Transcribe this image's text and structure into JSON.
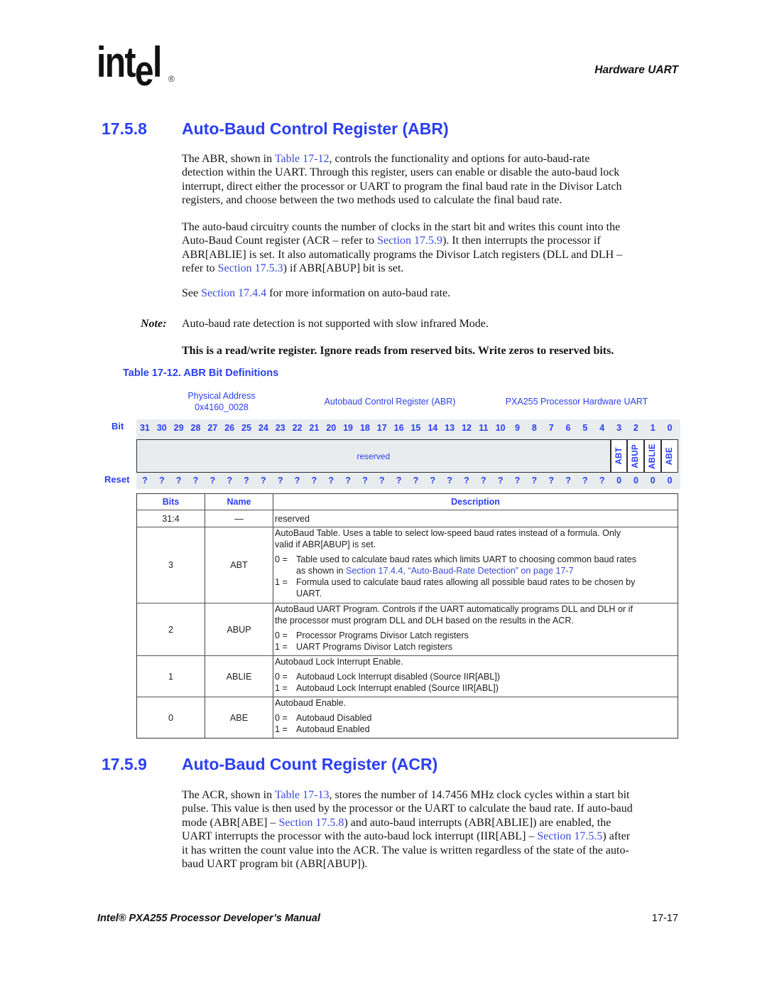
{
  "header": {
    "logo": {
      "part1": "int",
      "part2": "e",
      "part3": "l"
    },
    "logo_mark": "®",
    "section_label": "Hardware UART"
  },
  "section_abr": {
    "number": "17.5.8",
    "title": "Auto-Baud Control Register (ABR)",
    "paragraph1": [
      [
        {
          "t": "The ABR, shown in "
        },
        {
          "t": "Table 17-12",
          "link": true
        },
        {
          "t": ", controls the functionality and options for auto-baud-rate"
        }
      ],
      [
        {
          "t": "detection within the UART. Through this register, users can enable or disable the auto-baud lock"
        }
      ],
      [
        {
          "t": "interrupt, direct either the processor or UART to program the final baud rate in the Divisor Latch"
        }
      ],
      [
        {
          "t": "registers, and choose between the two methods used to calculate the final baud rate."
        }
      ]
    ],
    "paragraph2": [
      [
        {
          "t": "The auto-baud circuitry counts the number of clocks in the start bit and writes this count into the"
        }
      ],
      [
        {
          "t": "Auto-Baud Count register (ACR – refer to "
        },
        {
          "t": "Section 17.5.9",
          "link": true
        },
        {
          "t": "). It then interrupts the processor if"
        }
      ],
      [
        {
          "t": "ABR[ABLIE] is set. It also automatically programs the Divisor Latch registers (DLL and DLH –"
        }
      ],
      [
        {
          "t": "refer to "
        },
        {
          "t": "Section 17.5.3",
          "link": true
        },
        {
          "t": ") if ABR[ABUP] bit is set."
        }
      ]
    ],
    "paragraph3": [
      [
        {
          "t": "See "
        },
        {
          "t": "Section 17.4.4",
          "link": true
        },
        {
          "t": " for more information on auto-baud rate."
        }
      ]
    ],
    "note": {
      "label": "Note:",
      "text": "Auto-baud rate detection is not supported with slow infrared Mode."
    },
    "access_statement": "This is a read/write register. Ignore reads from reserved bits. Write zeros to reserved bits."
  },
  "table": {
    "caption": "Table 17-12. ABR Bit Definitions",
    "register": {
      "physical_address_label": "Physical Address",
      "physical_address": "0x4160_0028",
      "name": "Autobaud Control Register (ABR)",
      "unit": "PXA255 Processor Hardware UART",
      "bit_label": "Bit",
      "bits": [
        "31",
        "30",
        "29",
        "28",
        "27",
        "26",
        "25",
        "24",
        "23",
        "22",
        "21",
        "20",
        "19",
        "18",
        "17",
        "16",
        "15",
        "14",
        "13",
        "12",
        "11",
        "10",
        "9",
        "8",
        "7",
        "6",
        "5",
        "4",
        "3",
        "2",
        "1",
        "0"
      ],
      "fields": [
        {
          "name": "reserved",
          "msb": 31,
          "lsb": 4
        },
        {
          "name": "ABT",
          "msb": 3,
          "lsb": 3
        },
        {
          "name": "ABUP",
          "msb": 2,
          "lsb": 2
        },
        {
          "name": "ABLIE",
          "msb": 1,
          "lsb": 1
        },
        {
          "name": "ABE",
          "msb": 0,
          "lsb": 0
        }
      ],
      "reset_label": "Reset",
      "reset_values": [
        "?",
        "?",
        "?",
        "?",
        "?",
        "?",
        "?",
        "?",
        "?",
        "?",
        "?",
        "?",
        "?",
        "?",
        "?",
        "?",
        "?",
        "?",
        "?",
        "?",
        "?",
        "?",
        "?",
        "?",
        "?",
        "?",
        "?",
        "?",
        "0",
        "0",
        "0",
        "0"
      ]
    },
    "columns": [
      "Bits",
      "Name",
      "Description"
    ],
    "rows": [
      {
        "bits": "31:4",
        "name": "—",
        "intro": [
          "reserved"
        ],
        "options": []
      },
      {
        "bits": "3",
        "name": "ABT",
        "intro": [
          "AutoBaud Table. Uses a table to select low-speed baud rates instead of a formula. Only",
          "valid if ABR[ABUP] is set."
        ],
        "options": [
          {
            "key": "0 =",
            "lines": [
              [
                {
                  "t": "Table used to calculate baud rates which limits UART to choosing common baud rates"
                }
              ],
              [
                {
                  "t": "as shown in "
                },
                {
                  "t": "Section 17.4.4, “Auto-Baud-Rate Detection” on page 17-7",
                  "link": true
                }
              ]
            ]
          },
          {
            "key": "1 =",
            "lines": [
              [
                {
                  "t": "Formula used to calculate baud rates allowing all possible baud rates to be chosen by"
                }
              ],
              [
                {
                  "t": "UART."
                }
              ]
            ]
          }
        ]
      },
      {
        "bits": "2",
        "name": "ABUP",
        "intro": [
          "AutoBaud UART Program. Controls if the UART automatically programs DLL and DLH or if",
          "the processor must program DLL and DLH based on the results in the ACR."
        ],
        "options": [
          {
            "key": "0 =",
            "lines": [
              [
                {
                  "t": "Processor Programs Divisor Latch registers"
                }
              ]
            ]
          },
          {
            "key": "1 =",
            "lines": [
              [
                {
                  "t": "UART Programs Divisor Latch registers"
                }
              ]
            ]
          }
        ]
      },
      {
        "bits": "1",
        "name": "ABLIE",
        "intro": [
          "Autobaud Lock Interrupt Enable."
        ],
        "options": [
          {
            "key": "0 =",
            "lines": [
              [
                {
                  "t": "Autobaud Lock Interrupt disabled (Source IIR[ABL])"
                }
              ]
            ]
          },
          {
            "key": "1 =",
            "lines": [
              [
                {
                  "t": "Autobaud Lock Interrupt enabled (Source IIR[ABL])"
                }
              ]
            ]
          }
        ]
      },
      {
        "bits": "0",
        "name": "ABE",
        "intro": [
          "Autobaud Enable."
        ],
        "options": [
          {
            "key": "0 =",
            "lines": [
              [
                {
                  "t": "Autobaud Disabled"
                }
              ]
            ]
          },
          {
            "key": "1 =",
            "lines": [
              [
                {
                  "t": "Autobaud Enabled"
                }
              ]
            ]
          }
        ]
      }
    ]
  },
  "section_acr": {
    "number": "17.5.9",
    "title": "Auto-Baud Count Register (ACR)",
    "paragraph1": [
      [
        {
          "t": "The ACR, shown in "
        },
        {
          "t": "Table 17-13",
          "link": true
        },
        {
          "t": ", stores the number of 14.7456 MHz clock cycles within a start bit"
        }
      ],
      [
        {
          "t": "pulse. This value is then used by the processor or the UART to calculate the baud rate. If auto-baud"
        }
      ],
      [
        {
          "t": "mode (ABR[ABE] – "
        },
        {
          "t": "Section 17.5.8",
          "link": true
        },
        {
          "t": ") and auto-baud interrupts (ABR[ABLIE]) are enabled, the"
        }
      ],
      [
        {
          "t": "UART interrupts the processor with the auto-baud lock interrupt (IIR[ABL] – "
        },
        {
          "t": "Section 17.5.5",
          "link": true
        },
        {
          "t": ") after"
        }
      ],
      [
        {
          "t": "it has written the count value into the ACR. The value is written regardless of the state of the auto-"
        }
      ],
      [
        {
          "t": "baud UART program bit (ABR[ABUP])."
        }
      ]
    ]
  },
  "footer": {
    "title": "Intel® PXA255 Processor Developer’s Manual",
    "page": "17-17"
  }
}
